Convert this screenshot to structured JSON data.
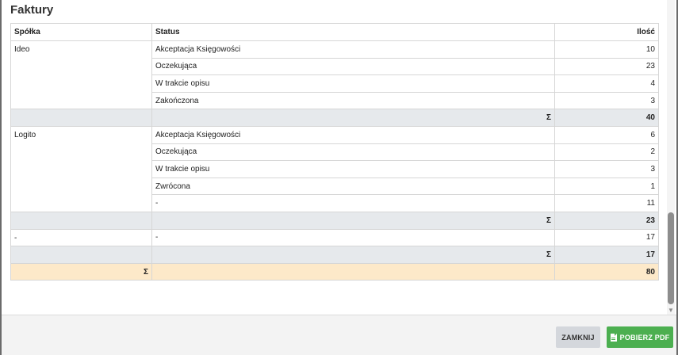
{
  "title": "Faktury",
  "table": {
    "headers": [
      "Spółka",
      "Status",
      "Ilość"
    ],
    "total_symbol": "Σ",
    "groups": [
      {
        "company": "Ideo",
        "rows": [
          {
            "status": "Akceptacja Księgowości",
            "count": "10"
          },
          {
            "status": "Oczekująca",
            "count": "23"
          },
          {
            "status": "W trakcie opisu",
            "count": "4"
          },
          {
            "status": "Zakończona",
            "count": "3"
          }
        ],
        "subtotal": "40"
      },
      {
        "company": "Logito",
        "rows": [
          {
            "status": "Akceptacja Księgowości",
            "count": "6"
          },
          {
            "status": "Oczekująca",
            "count": "2"
          },
          {
            "status": "W trakcie opisu",
            "count": "3"
          },
          {
            "status": "Zwrócona",
            "count": "1"
          },
          {
            "status": "-",
            "count": "11"
          }
        ],
        "subtotal": "23"
      },
      {
        "company": "-",
        "rows": [
          {
            "status": "-",
            "count": "17"
          }
        ],
        "subtotal": "17"
      }
    ],
    "grand_total": "80"
  },
  "footer": {
    "close_label": "ZAMKNIJ",
    "pdf_label": "POBIERZ PDF"
  },
  "icons": {
    "pdf": "pdf-file-icon"
  },
  "colors": {
    "subtotal_row": "#e6e9ec",
    "grandtotal_row": "#fde9c9",
    "pdf_button": "#4caf50",
    "close_button": "#d4d7dc"
  }
}
